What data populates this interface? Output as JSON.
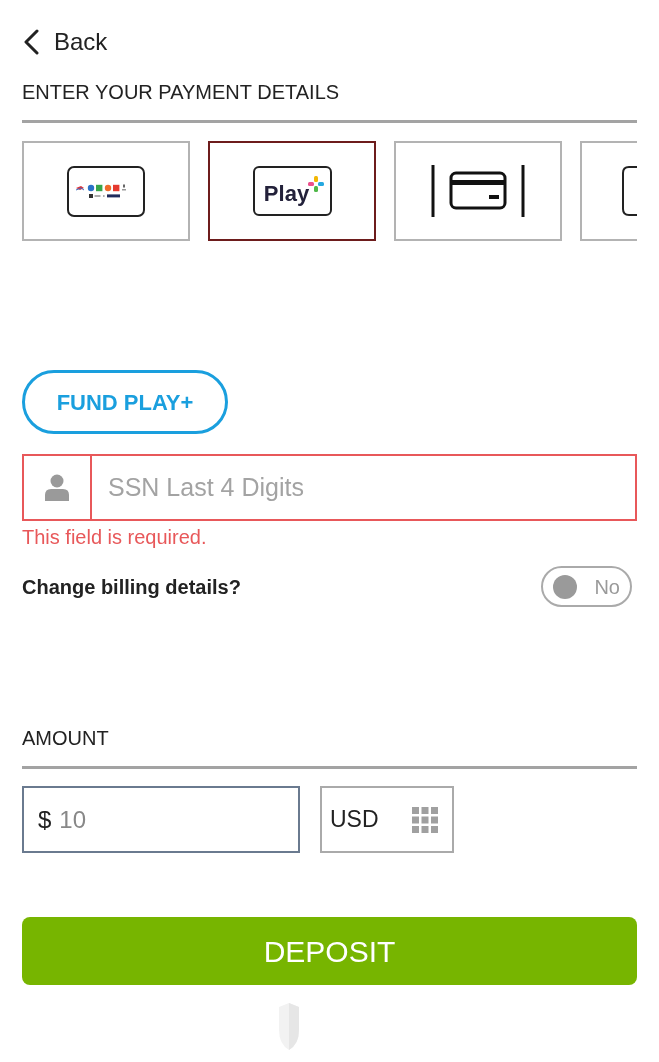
{
  "header": {
    "back_label": "Back",
    "title": "ENTER YOUR PAYMENT DETAILS"
  },
  "payment_methods": [
    {
      "kind": "bank-logos",
      "selected": false
    },
    {
      "kind": "play-plus",
      "label": "Play",
      "selected": true
    },
    {
      "kind": "card",
      "selected": false
    },
    {
      "kind": "cut-off",
      "selected": false
    }
  ],
  "fund_button": "FUND PLAY+",
  "ssn": {
    "placeholder": "SSN Last 4 Digits",
    "invalid": true,
    "error": "This field is required."
  },
  "billing": {
    "label": "Change billing details?",
    "on": false,
    "state_label": "No"
  },
  "amount": {
    "title": "AMOUNT",
    "symbol": "$",
    "value": "10",
    "currency": "USD"
  },
  "deposit_button": "DEPOSIT"
}
